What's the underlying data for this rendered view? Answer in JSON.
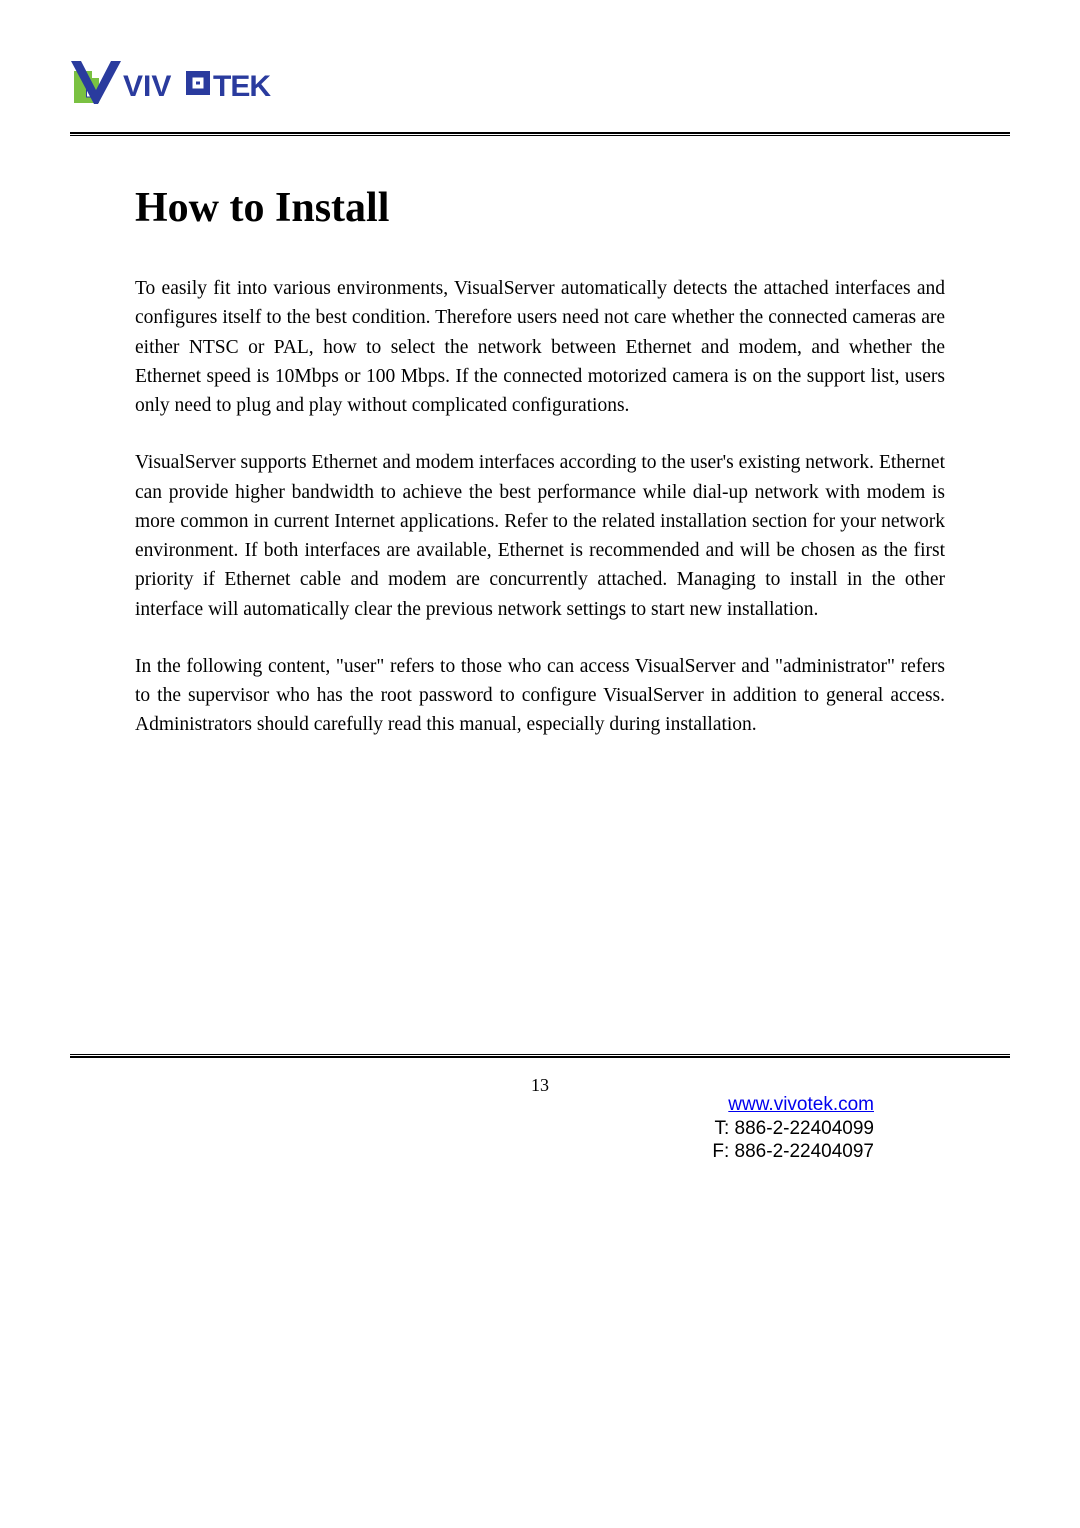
{
  "brand": {
    "name": "VIVOTEK",
    "logo_alt": "VIVOTEK logo"
  },
  "heading": "How to Install",
  "paragraphs": {
    "p1": "To easily fit into various environments, VisualServer automatically detects the attached interfaces and configures itself to the best condition. Therefore users need not care whether the connected cameras are either NTSC or PAL, how to select the network between Ethernet and modem, and whether the Ethernet speed is 10Mbps or 100 Mbps. If the connected motorized camera is on the support list, users only need to plug and play without complicated configurations.",
    "p2": "VisualServer supports Ethernet and modem interfaces according to the user's existing network. Ethernet can provide higher bandwidth to achieve the best performance while dial-up network with modem is more common in current Internet applications. Refer to the related installation section for your network environment. If both interfaces are available, Ethernet is recommended and will be chosen as the first priority if Ethernet cable and modem are concurrently attached. Managing to install in the other interface will automatically clear the previous network settings to start new installation.",
    "p3": "In the following content, \"user\" refers to those who can access VisualServer and \"administrator\" refers to the supervisor who has the root password to configure VisualServer in addition to general access. Administrators should carefully read this manual, especially during installation."
  },
  "page_number": "13",
  "footer": {
    "url": "www.vivotek.com",
    "tel": "T: 886-2-22404099",
    "fax": "F: 886-2-22404097"
  },
  "colors": {
    "brand_blue": "#2a3b9e",
    "brand_green": "#7ac142"
  }
}
